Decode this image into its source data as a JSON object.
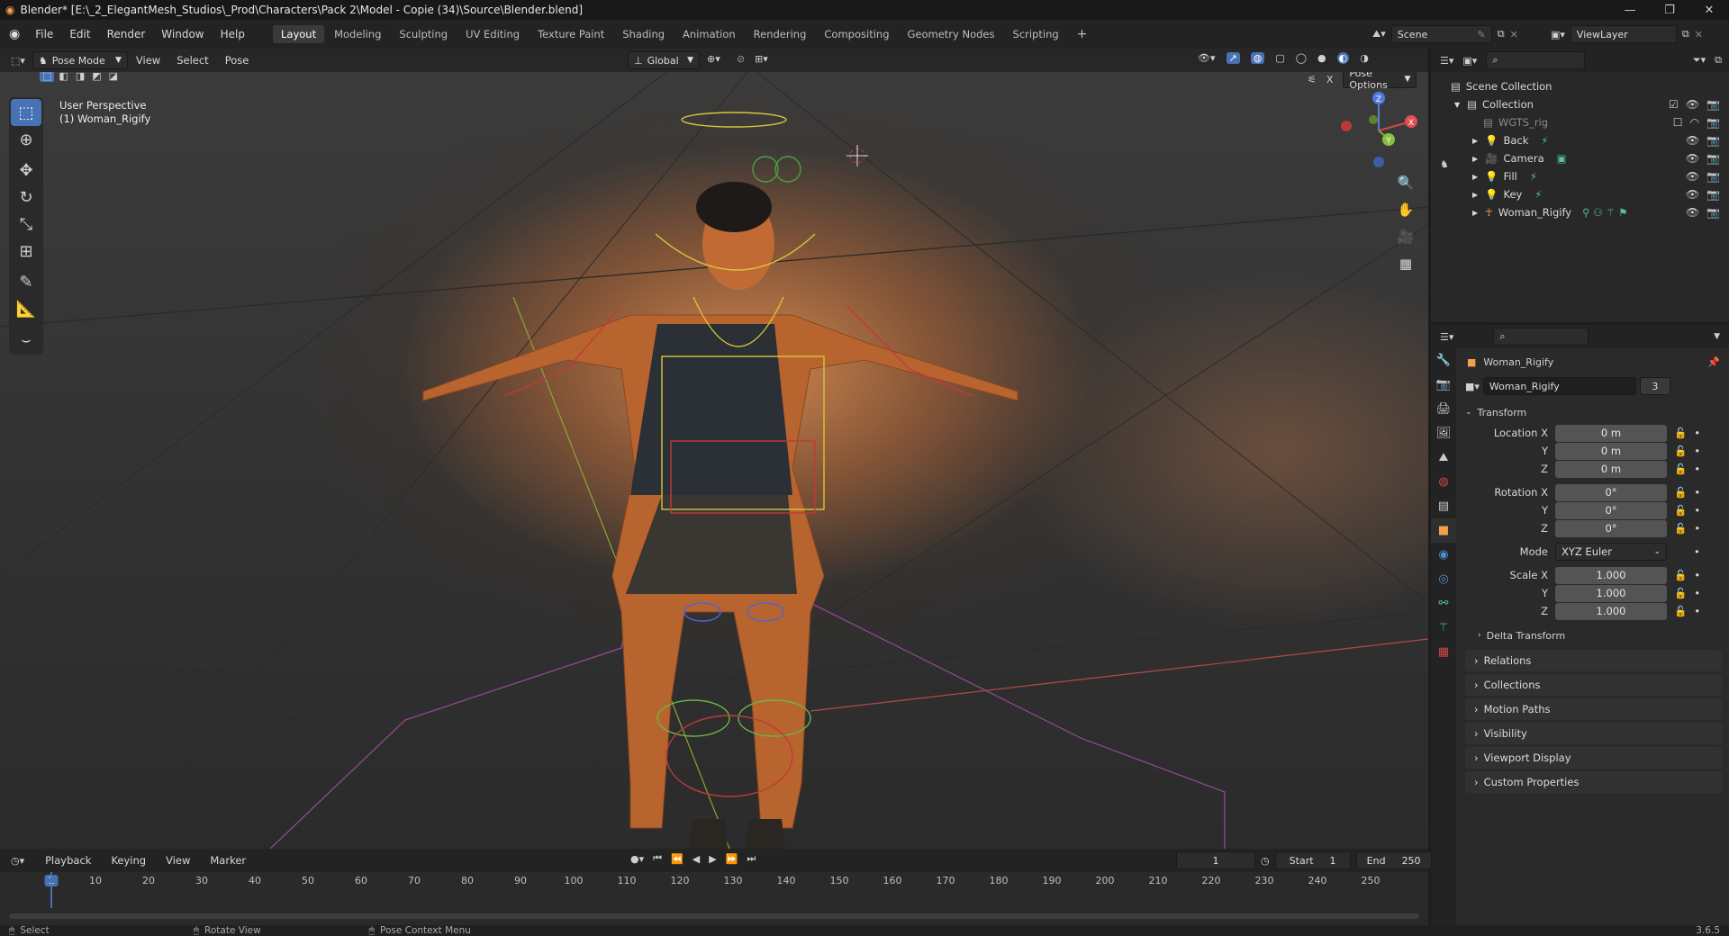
{
  "title": "Blender* [E:\\_2_ElegantMesh_Studios\\_Prod\\Characters\\Pack 2\\Model - Copie (34)\\Source\\Blender.blend]",
  "menus": [
    "File",
    "Edit",
    "Render",
    "Window",
    "Help"
  ],
  "workspaces": [
    "Layout",
    "Modeling",
    "Sculpting",
    "UV Editing",
    "Texture Paint",
    "Shading",
    "Animation",
    "Rendering",
    "Compositing",
    "Geometry Nodes",
    "Scripting"
  ],
  "active_workspace": "Layout",
  "scene": "Scene",
  "view_layer": "ViewLayer",
  "viewport": {
    "mode": "Pose Mode",
    "menus": [
      "View",
      "Select",
      "Pose"
    ],
    "orientation": "Global",
    "pose_options": "Pose Options",
    "info_line1": "User Perspective",
    "info_line2": "(1) Woman_Rigify"
  },
  "outliner": {
    "root": "Scene Collection",
    "collection": "Collection",
    "items": [
      "WGTS_rig",
      "Back",
      "Camera",
      "Fill",
      "Key",
      "Woman_Rigify"
    ]
  },
  "properties": {
    "object_name": "Woman_Rigify",
    "datablock": "Woman_Rigify",
    "users": "3",
    "section": "Transform",
    "location": {
      "label": "Location X",
      "x": "0 m",
      "y": "0 m",
      "z": "0 m"
    },
    "rotation": {
      "label": "Rotation X",
      "x": "0°",
      "y": "0°",
      "z": "0°"
    },
    "mode_label": "Mode",
    "mode_value": "XYZ Euler",
    "scale": {
      "label": "Scale X",
      "x": "1.000",
      "y": "1.000",
      "z": "1.000"
    },
    "axis_y": "Y",
    "axis_z": "Z",
    "delta": "Delta Transform",
    "panels": [
      "Relations",
      "Collections",
      "Motion Paths",
      "Visibility",
      "Viewport Display",
      "Custom Properties"
    ]
  },
  "timeline": {
    "menus": [
      "Playback",
      "Keying",
      "View",
      "Marker"
    ],
    "current_frame": "1",
    "start_label": "Start",
    "start": "1",
    "end_label": "End",
    "end": "250",
    "ticks": [
      "1",
      "10",
      "20",
      "30",
      "40",
      "50",
      "60",
      "70",
      "80",
      "90",
      "100",
      "110",
      "120",
      "130",
      "140",
      "150",
      "160",
      "170",
      "180",
      "190",
      "200",
      "210",
      "220",
      "230",
      "240",
      "250"
    ]
  },
  "status": {
    "left": "Select",
    "middle": "Rotate View",
    "right": "Pose Context Menu",
    "version": "3.6.5"
  },
  "colors": {
    "accent": "#4772b3",
    "active_object": "#f3a14b"
  }
}
